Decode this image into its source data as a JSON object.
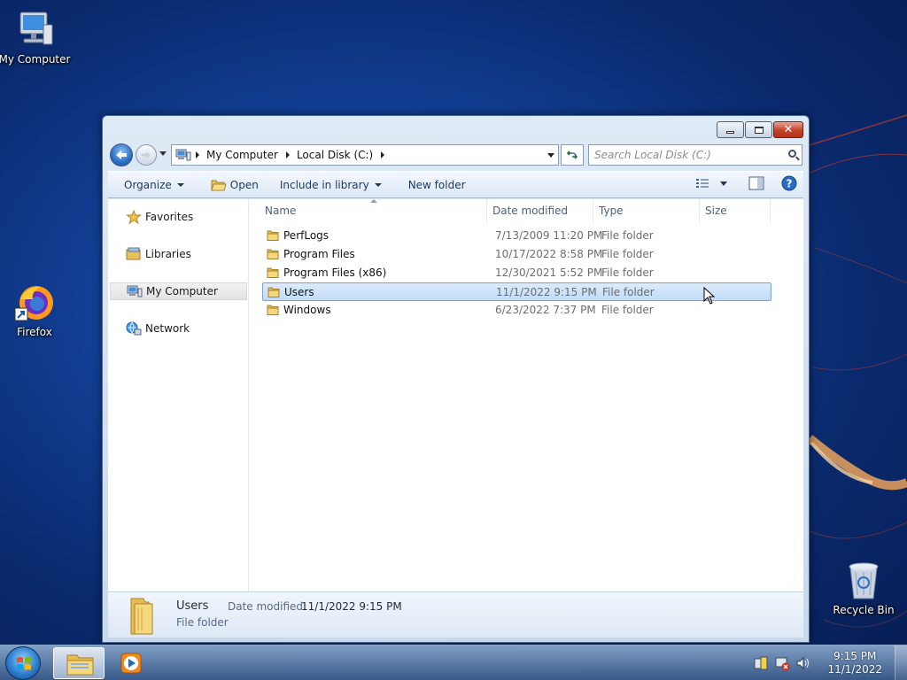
{
  "desktop": {
    "icons": [
      {
        "label": "My Computer"
      },
      {
        "label": "Firefox"
      },
      {
        "label": "Recycle Bin"
      }
    ]
  },
  "address_bar": {
    "crumbs": [
      "My Computer",
      "Local Disk (C:)"
    ]
  },
  "search": {
    "placeholder": "Search Local Disk (C:)"
  },
  "toolbar": {
    "organize": "Organize",
    "open": "Open",
    "include": "Include in library",
    "new_folder": "New folder"
  },
  "nav_pane": {
    "items": [
      {
        "label": "Favorites",
        "icon": "star-icon"
      },
      {
        "label": "Libraries",
        "icon": "libraries-icon"
      },
      {
        "label": "My Computer",
        "icon": "computer-icon",
        "selected": true
      },
      {
        "label": "Network",
        "icon": "network-icon"
      }
    ]
  },
  "columns": {
    "name": "Name",
    "date": "Date modified",
    "type": "Type",
    "size": "Size"
  },
  "files": [
    {
      "name": "PerfLogs",
      "date": "7/13/2009 11:20 PM",
      "type": "File folder",
      "selected": false
    },
    {
      "name": "Program Files",
      "date": "10/17/2022 8:58 PM",
      "type": "File folder",
      "selected": false
    },
    {
      "name": "Program Files (x86)",
      "date": "12/30/2021 5:52 PM",
      "type": "File folder",
      "selected": false
    },
    {
      "name": "Users",
      "date": "11/1/2022 9:15 PM",
      "type": "File folder",
      "selected": true
    },
    {
      "name": "Windows",
      "date": "6/23/2022 7:37 PM",
      "type": "File folder",
      "selected": false
    }
  ],
  "details": {
    "name": "Users",
    "type": "File folder",
    "modified_label": "Date modified:",
    "modified_value": "11/1/2022 9:15 PM"
  },
  "taskbar": {
    "time": "9:15 PM",
    "date": "11/1/2022"
  },
  "colors": {
    "accent": "#2b6fc4",
    "selection": "#c1dcf8",
    "desktop": "#123f95"
  }
}
